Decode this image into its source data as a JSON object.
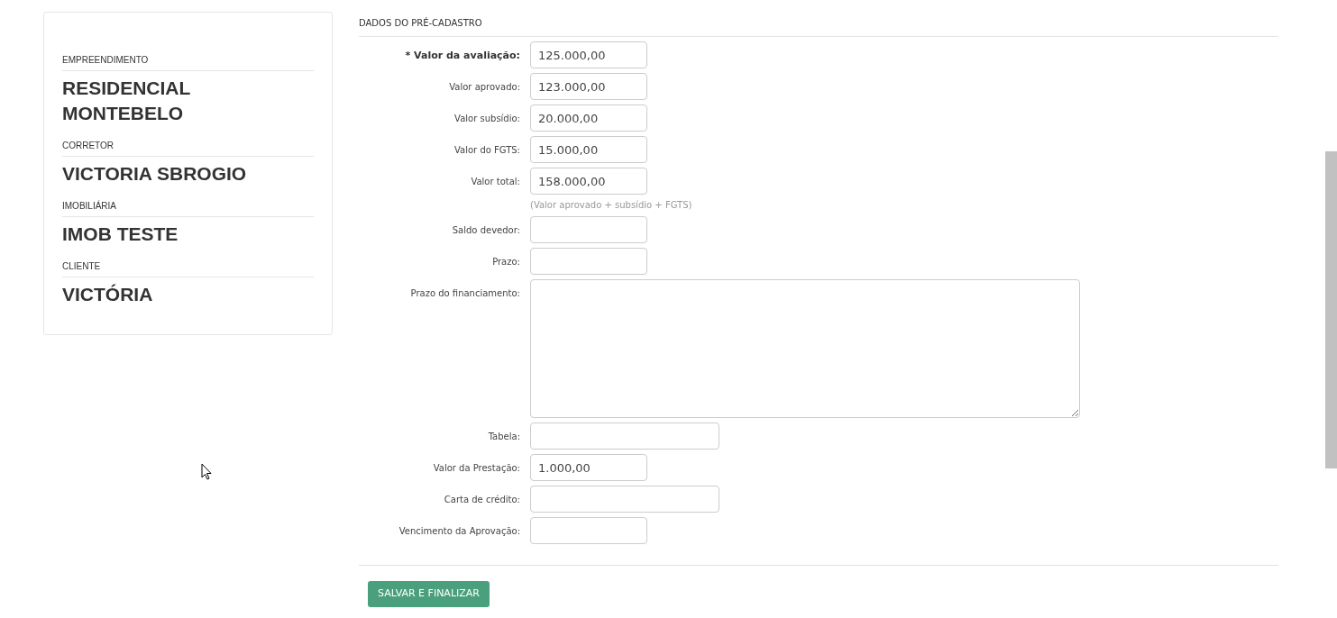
{
  "summary": [
    {
      "label": "EMPREENDIMENTO",
      "value": "RESIDENCIAL MONTEBELO"
    },
    {
      "label": "CORRETOR",
      "value": "VICTORIA SBROGIO"
    },
    {
      "label": "IMOBILIÁRIA",
      "value": "IMOB TESTE"
    },
    {
      "label": "CLIENTE",
      "value": "VICTÓRIA"
    }
  ],
  "form": {
    "title": "DADOS DO PRÉ-CADASTRO",
    "fields": [
      {
        "label": "* Valor da avaliação:",
        "required": true,
        "kind": "short",
        "value": "125.000,00"
      },
      {
        "label": "Valor aprovado:",
        "required": false,
        "kind": "short",
        "value": "123.000,00"
      },
      {
        "label": "Valor subsídio:",
        "required": false,
        "kind": "short",
        "value": "20.000,00"
      },
      {
        "label": "Valor do FGTS:",
        "required": false,
        "kind": "short",
        "value": "15.000,00"
      },
      {
        "label": "Valor total:",
        "required": false,
        "kind": "short",
        "value": "158.000,00",
        "hint": "(Valor aprovado + subsídio + FGTS)"
      },
      {
        "label": "Saldo devedor:",
        "required": false,
        "kind": "short"
      },
      {
        "label": "Prazo:",
        "required": false,
        "kind": "short"
      },
      {
        "label": "Prazo do financiamento:",
        "required": false,
        "kind": "textarea"
      },
      {
        "label": "Tabela:",
        "required": false,
        "kind": "medium"
      },
      {
        "label": "Valor da Prestação:",
        "required": false,
        "kind": "short",
        "value": "1.000,00"
      },
      {
        "label": "Carta de crédito:",
        "required": false,
        "kind": "medium"
      },
      {
        "label": "Vencimento da Aprovação:",
        "required": false,
        "kind": "short"
      }
    ],
    "submit": "SALVAR E FINALIZAR"
  }
}
